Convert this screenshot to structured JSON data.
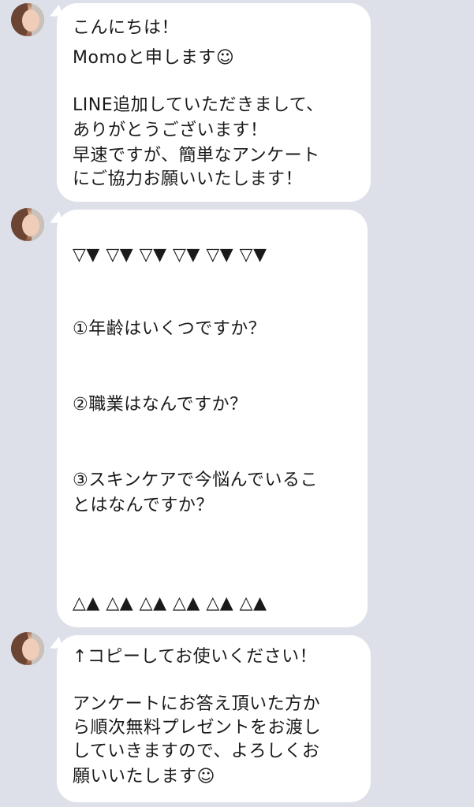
{
  "messages": [
    {
      "sender_avatar": "user-avatar-photo",
      "lines": [
        "こんにちは！",
        "Momoと申します☺",
        "",
        "LINE追加していただきまして、",
        "ありがとうございます！",
        "早速ですが、簡単なアンケート",
        "にご協力お願いいたします！"
      ]
    },
    {
      "sender_avatar": "user-avatar-photo",
      "lines": [
        "▽▼ ▽▼ ▽▼ ▽▼ ▽▼ ▽▼",
        "①年齢はいくつですか？",
        "②職業はなんですか？",
        "③スキンケアで今悩んでいるこ",
        "とはなんですか？",
        "△▲ △▲ △▲ △▲ △▲ △▲"
      ]
    },
    {
      "sender_avatar": "user-avatar-photo",
      "lines": [
        "↑コピーしてお使いください！",
        "",
        "アンケートにお答え頂いた方か",
        "ら順次無料プレゼントをお渡し",
        "していきますので、よろしくお",
        "願いいたします☺"
      ]
    }
  ]
}
